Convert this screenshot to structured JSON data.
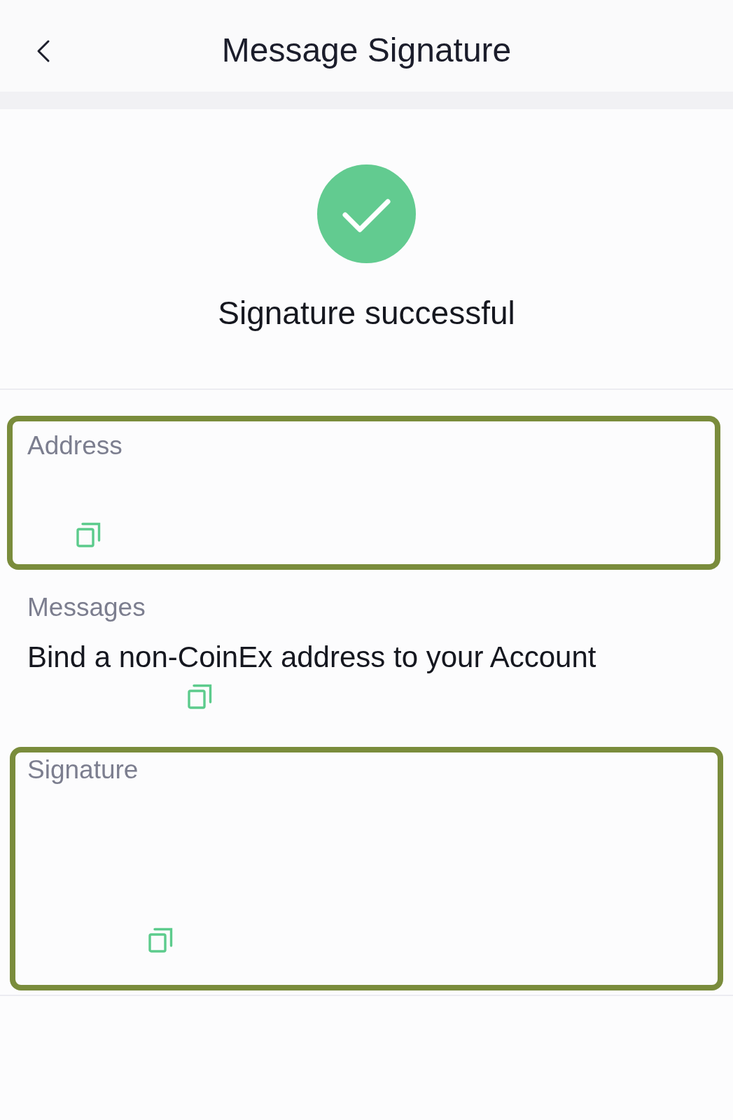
{
  "header": {
    "title": "Message Signature"
  },
  "result": {
    "kind": "success",
    "text": "Signature successful"
  },
  "fields": [
    {
      "label": "Address",
      "highlighted": true
    },
    {
      "label": "Messages",
      "value": "Bind a non-CoinEx address to your Account",
      "highlighted": false
    },
    {
      "label": "Signature",
      "highlighted": true
    }
  ]
}
